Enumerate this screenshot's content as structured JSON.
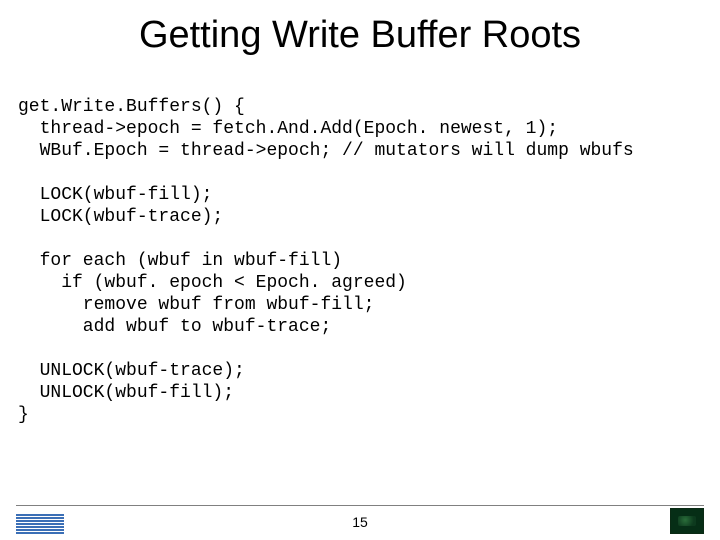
{
  "title": "Getting Write Buffer Roots",
  "code_lines": [
    "get.Write.Buffers() {",
    "  thread->epoch = fetch.And.Add(Epoch. newest, 1);",
    "  WBuf.Epoch = thread->epoch; // mutators will dump wbufs",
    "",
    "  LOCK(wbuf-fill);",
    "  LOCK(wbuf-trace);",
    "",
    "  for each (wbuf in wbuf-fill)",
    "    if (wbuf. epoch < Epoch. agreed)",
    "      remove wbuf from wbuf-fill;",
    "      add wbuf to wbuf-trace;",
    "",
    "  UNLOCK(wbuf-trace);",
    "  UNLOCK(wbuf-fill);",
    "}"
  ],
  "page_number": "15",
  "logo_left_name": "ibm-logo",
  "logo_right_name": "corner-badge"
}
